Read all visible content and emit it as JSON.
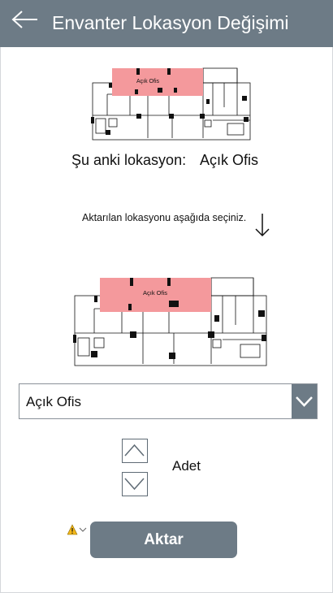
{
  "header": {
    "title": "Envanter Lokasyon Değişimi",
    "back_icon": "arrow-left-icon"
  },
  "current_location": {
    "label": "Şu anki lokasyon:",
    "value": "Açık Ofis"
  },
  "floorplan_top": {
    "room_label": "Açık Ofis"
  },
  "instruction": {
    "text": "Aktarılan lokasyonu aşağıda seçiniz.",
    "icon": "arrow-down-icon"
  },
  "floorplan_bottom": {
    "room_label": "Açık Ofis"
  },
  "location_select": {
    "selected": "Açık Ofis",
    "icon": "chevron-down-icon"
  },
  "quantity": {
    "label": "Adet",
    "up_icon": "chevron-up-icon",
    "down_icon": "chevron-down-icon"
  },
  "warning": {
    "icon": "warning-icon"
  },
  "submit": {
    "label": "Aktar"
  },
  "colors": {
    "header": "#6d7b86",
    "highlight": "#f4999c",
    "button": "#6d7b86"
  }
}
